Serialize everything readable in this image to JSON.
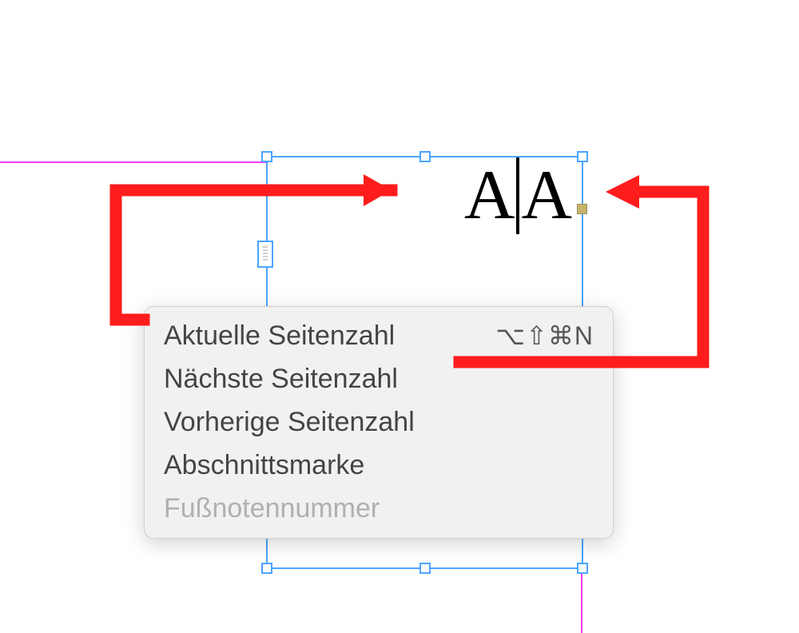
{
  "frame": {
    "text_a1": "A",
    "text_a2": "A"
  },
  "menu": {
    "items": [
      {
        "label": "Aktuelle Seitenzahl",
        "shortcut": "⌥⇧⌘N",
        "disabled": false
      },
      {
        "label": "Nächste Seitenzahl",
        "shortcut": "",
        "disabled": false
      },
      {
        "label": "Vorherige Seitenzahl",
        "shortcut": "",
        "disabled": false
      },
      {
        "label": "Abschnittsmarke",
        "shortcut": "",
        "disabled": false
      },
      {
        "label": "Fußnotennummer",
        "shortcut": "",
        "disabled": true
      }
    ]
  },
  "annotation_color": "#ff1c1c"
}
